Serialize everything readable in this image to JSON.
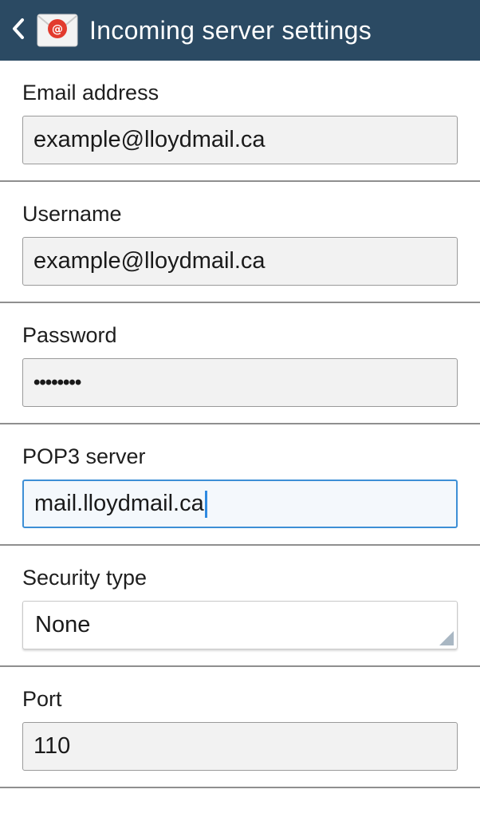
{
  "header": {
    "title": "Incoming server settings",
    "back_icon": "chevron-left-icon",
    "app_icon": "email-app-icon",
    "background_color": "#2b4a63"
  },
  "form": {
    "email": {
      "label": "Email address",
      "value": "example@lloydmail.ca"
    },
    "username": {
      "label": "Username",
      "value": "example@lloydmail.ca"
    },
    "password": {
      "label": "Password",
      "value": "••••••••"
    },
    "server": {
      "label": "POP3 server",
      "value": "mail.lloydmail.ca",
      "focused": true,
      "focus_color": "#3d8fd6"
    },
    "security": {
      "label": "Security type",
      "value": "None"
    },
    "port": {
      "label": "Port",
      "value": "110"
    }
  }
}
